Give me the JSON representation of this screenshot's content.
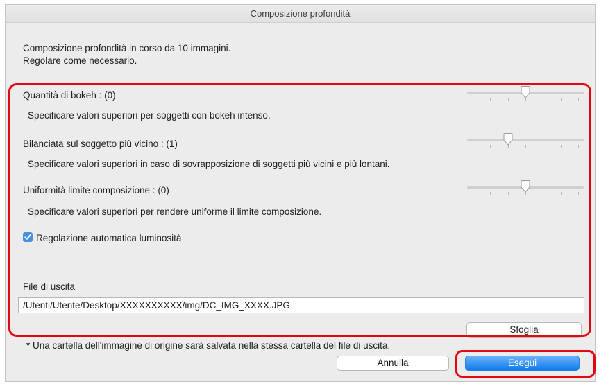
{
  "window": {
    "title": "Composizione profondità"
  },
  "intro": {
    "line1": "Composizione profondità in corso da 10 immagini.",
    "line2": "Regolare come necessario."
  },
  "settings": [
    {
      "label": "Quantità di bokeh : (0)",
      "hint": "Specificare valori superiori per soggetti con bokeh intenso.",
      "value": 0,
      "position": 0.5
    },
    {
      "label": "Bilanciata sul soggetto più vicino : (1)",
      "hint": "Specificare valori superiori in caso di sovrapposizione di soggetti più vicini e più lontani.",
      "value": 1,
      "position": 0.333
    },
    {
      "label": "Uniformità limite composizione : (0)",
      "hint": "Specificare valori superiori per rendere uniforme il limite composizione.",
      "value": 0,
      "position": 0.5
    }
  ],
  "auto_brightness": {
    "label": "Regolazione automatica luminosità",
    "checked": true
  },
  "output": {
    "label": "File di uscita",
    "path": "/Utenti/Utente/Desktop/XXXXXXXXXX/img/DC_IMG_XXXX.JPG",
    "browse_label": "Sfoglia"
  },
  "note": "* Una cartella dell'immagine di origine sarà salvata nella stessa cartella del file di uscita.",
  "buttons": {
    "cancel": "Annulla",
    "run": "Esegui"
  },
  "colors": {
    "highlight": "#e30613",
    "accent": "#1a7ff0",
    "checkbox": "#4a90e2"
  }
}
